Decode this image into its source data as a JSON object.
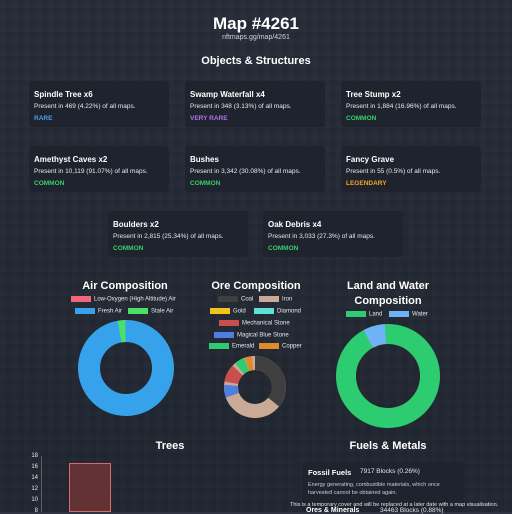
{
  "header": {
    "title": "Map #4261",
    "url": "nftmaps.gg/map/4261"
  },
  "objects": {
    "heading": "Objects & Structures",
    "cards": [
      {
        "name": "Spindle Tree x6",
        "presence": "Present in 469 (4.22%) of all maps.",
        "rarity": "RARE",
        "rarity_color": "#4f9bf0"
      },
      {
        "name": "Swamp Waterfall x4",
        "presence": "Present in 348 (3.13%) of all maps.",
        "rarity": "VERY RARE",
        "rarity_color": "#b26df0"
      },
      {
        "name": "Tree Stump x2",
        "presence": "Present in 1,884 (16.96%) of all maps.",
        "rarity": "COMMON",
        "rarity_color": "#37d06a"
      },
      {
        "name": "Amethyst Caves x2",
        "presence": "Present in 10,119 (91.07%) of all maps.",
        "rarity": "COMMON",
        "rarity_color": "#37d06a"
      },
      {
        "name": "Bushes",
        "presence": "Present in 3,342 (30.08%) of all maps.",
        "rarity": "COMMON",
        "rarity_color": "#37d06a"
      },
      {
        "name": "Fancy Grave",
        "presence": "Present in 55 (0.5%) of all maps.",
        "rarity": "LEGENDARY",
        "rarity_color": "#f5a623"
      },
      {
        "name": "Boulders x2",
        "presence": "Present in 2,815 (25.34%) of all maps.",
        "rarity": "COMMON",
        "rarity_color": "#37d06a"
      },
      {
        "name": "Oak Debris x4",
        "presence": "Present in 3,033 (27.3%) of all maps.",
        "rarity": "COMMON",
        "rarity_color": "#37d06a"
      }
    ]
  },
  "air": {
    "heading": "Air Composition",
    "legend": [
      {
        "label": "Low-Oxygen (High Altitude) Air",
        "color": "#f0677d"
      },
      {
        "label": "Fresh Air",
        "color": "#36a2eb"
      },
      {
        "label": "Stale Air",
        "color": "#4be06a"
      }
    ]
  },
  "ore": {
    "heading": "Ore Composition",
    "legend": [
      {
        "label": "Coal",
        "color": "#3f3f3f"
      },
      {
        "label": "Iron",
        "color": "#c9aa96"
      },
      {
        "label": "Gold",
        "color": "#f2c318"
      },
      {
        "label": "Diamond",
        "color": "#5ee0d9"
      },
      {
        "label": "Mechanical Stone",
        "color": "#c94f4f"
      },
      {
        "label": "Magical Blue Stone",
        "color": "#4e7fe0"
      },
      {
        "label": "Emerald",
        "color": "#2ecc71"
      },
      {
        "label": "Copper",
        "color": "#e08a2e"
      }
    ]
  },
  "land": {
    "heading_line1": "Land and Water",
    "heading_line2": "Composition",
    "legend": [
      {
        "label": "Land",
        "color": "#2ecc71"
      },
      {
        "label": "Water",
        "color": "#6fb2f5"
      }
    ]
  },
  "trees": {
    "heading": "Trees",
    "yticks": [
      "18",
      "16",
      "14",
      "12",
      "10",
      "8"
    ]
  },
  "fuels": {
    "heading": "Fuels & Metals",
    "item_name": "Fossil Fuels",
    "item_value": "7917 Blocks (0.26%)",
    "item_desc_1": "Energy generating, combustible materials, which once",
    "item_desc_2": "harvested cannot be obtained again.",
    "next_name": "Ores & Minerals",
    "next_value": "34463 Blocks (0.88%)"
  },
  "tooltip": {
    "text": "This is a temporary cover and will be replaced at a later date with a map visualisation."
  }
}
